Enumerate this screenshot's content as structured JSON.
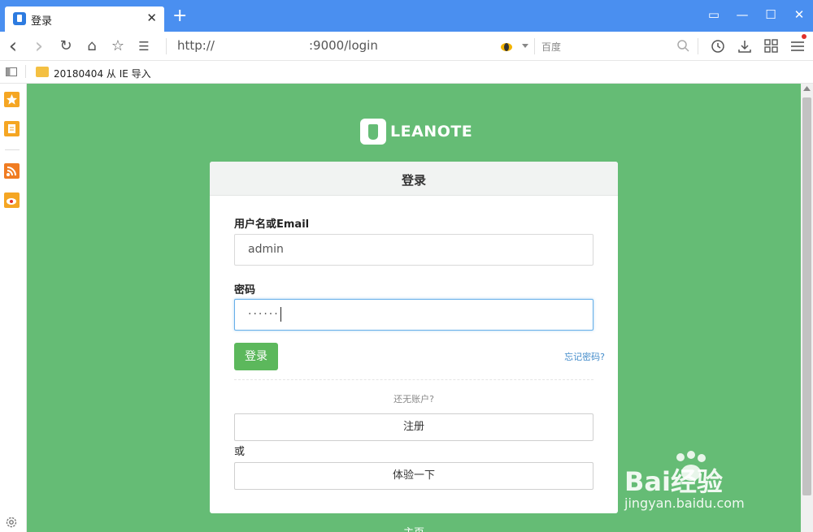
{
  "browser": {
    "tab_title": "登录",
    "close_glyph": "✕",
    "new_tab_glyph": "+",
    "url_prefix": "http://",
    "url_suffix": ":9000/login",
    "search_placeholder": "百度",
    "window_controls": {
      "layout": "▭",
      "minimize": "—",
      "maximize": "☐",
      "close": "✕"
    },
    "nav": {
      "back": "‹",
      "forward": "›",
      "refresh": "↻",
      "home": "⌂",
      "star": "☆",
      "reader": "☰"
    }
  },
  "bookmarks": [
    {
      "label": "20180404 从 IE 导入"
    }
  ],
  "sidebar": {
    "icons": [
      "star-icon",
      "note-icon",
      "rss-icon",
      "weibo-icon"
    ],
    "settings": "⚙"
  },
  "brand": {
    "logo_text": "LEANOTE"
  },
  "login": {
    "title": "登录",
    "username_label": "用户名或Email",
    "username_value": "admin",
    "password_label": "密码",
    "password_value": "······",
    "submit_label": "登录",
    "forgot_label": "忘记密码?",
    "no_account_text": "还无账户?",
    "register_label": "注册",
    "or_text": "或",
    "try_label": "体验一下"
  },
  "footer": {
    "home_link": "主页"
  },
  "watermark": {
    "line1": "Bai经验",
    "line2": "jingyan.baidu.com"
  },
  "colors": {
    "titlebar": "#4a8ff0",
    "page_bg": "#65bc75",
    "button_green": "#5cb85c",
    "link_blue": "#428bca"
  }
}
